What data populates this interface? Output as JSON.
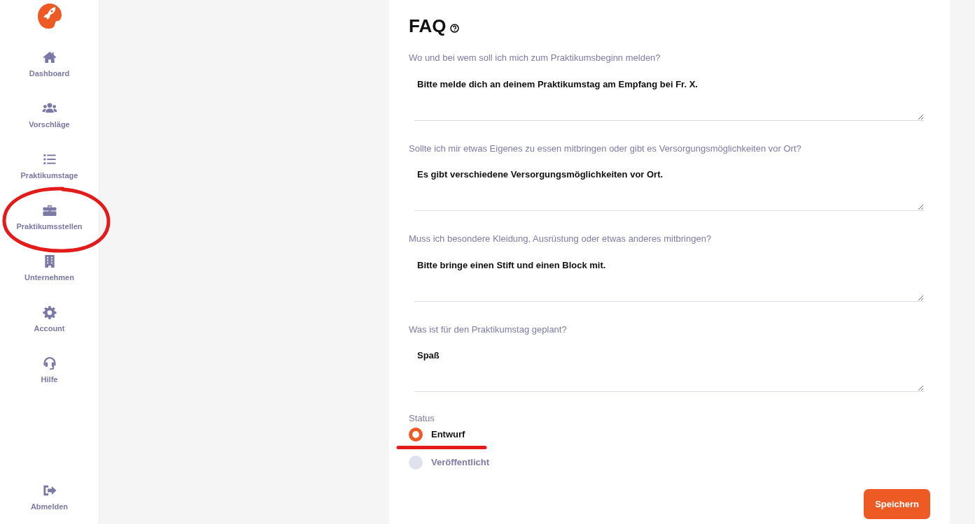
{
  "sidebar": {
    "items": [
      {
        "kind": "home",
        "label": "Dashboard",
        "circled": false
      },
      {
        "kind": "users",
        "label": "Vorschläge",
        "circled": false
      },
      {
        "kind": "list",
        "label": "Praktikumstage",
        "circled": false
      },
      {
        "kind": "briefcase",
        "label": "Praktikumsstellen",
        "circled": true
      },
      {
        "kind": "building",
        "label": "Unternehmen",
        "circled": false
      },
      {
        "kind": "gear",
        "label": "Account",
        "circled": false
      },
      {
        "kind": "headset",
        "label": "Hilfe",
        "circled": false
      }
    ],
    "footer": {
      "kind": "logout",
      "label": "Abmelden"
    }
  },
  "title": "FAQ",
  "faq": [
    {
      "question": "Wo und bei wem soll ich mich zum Praktikumsbeginn melden?",
      "answer": "Bitte melde dich an deinem Praktikumstag am Empfang bei Fr. X."
    },
    {
      "question": "Sollte ich mir etwas Eigenes zu essen mitbringen oder gibt es Versorgungsmöglichkeiten vor Ort?",
      "answer": "Es gibt verschiedene Versorgungsmöglichkeiten vor Ort."
    },
    {
      "question": "Muss ich besondere Kleidung, Ausrüstung oder etwas anderes mitbringen?",
      "answer": "Bitte bringe einen Stift und einen Block mit."
    },
    {
      "question": "Was ist für den Praktikumstag geplant?",
      "answer": "Spaß"
    }
  ],
  "status": {
    "label": "Status",
    "options": [
      {
        "label": "Entwurf",
        "selected": true,
        "underlined": true
      },
      {
        "label": "Veröffentlicht",
        "selected": false,
        "underlined": false
      }
    ]
  },
  "save_button": "Speichern"
}
